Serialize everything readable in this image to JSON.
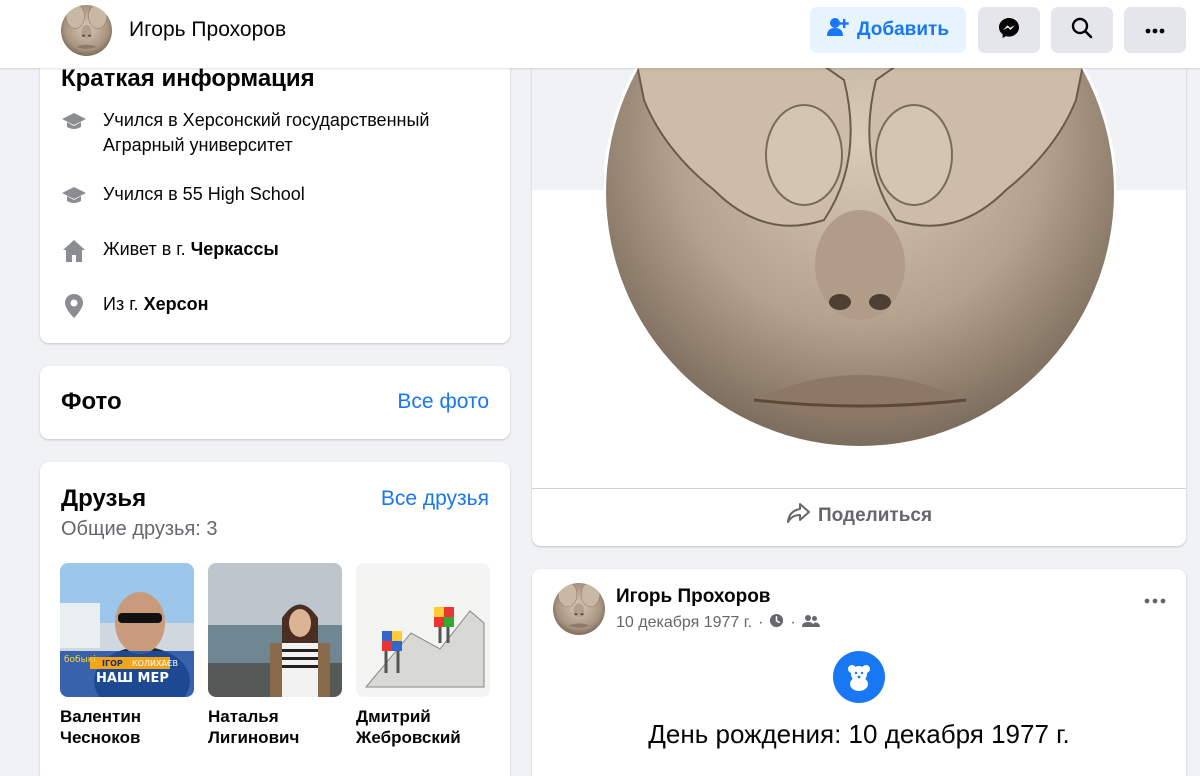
{
  "header": {
    "name": "Игорь Прохоров",
    "add_label": "Добавить"
  },
  "intro": {
    "title": "Краткая информация",
    "items": [
      {
        "icon": "graduation-cap-icon",
        "text": "Учился в Херсонский государственный Аграрный университет"
      },
      {
        "icon": "graduation-cap-icon",
        "text": "Учился в 55 High School"
      },
      {
        "icon": "home-icon",
        "prefix": "Живет в г. ",
        "bold": "Черкассы"
      },
      {
        "icon": "location-pin-icon",
        "prefix": "Из г. ",
        "bold": "Херсон"
      }
    ]
  },
  "photos": {
    "title": "Фото",
    "link": "Все фото"
  },
  "friends": {
    "title": "Друзья",
    "link": "Все друзья",
    "mutual": "Общие друзья: 3",
    "list": [
      {
        "first": "Валентин",
        "last": "Чесноков",
        "photo_text": [
          "бобыкі",
          "ІГОР",
          "КОЛИХАЄВ",
          "НАШ МЕР"
        ]
      },
      {
        "first": "Наталья",
        "last": "Лигинович"
      },
      {
        "first": "Дмитрий",
        "last": "Жебровский"
      }
    ]
  },
  "profile_picture": {
    "share_label": "Поделиться"
  },
  "post": {
    "author": "Игорь Прохоров",
    "date": "10 декабря 1977 г.",
    "separator": "·",
    "event": "День рождения: 10 декабря 1977 г."
  },
  "colors": {
    "accent": "#1877f2",
    "background": "#f0f2f5",
    "secondary_text": "#65676b"
  }
}
